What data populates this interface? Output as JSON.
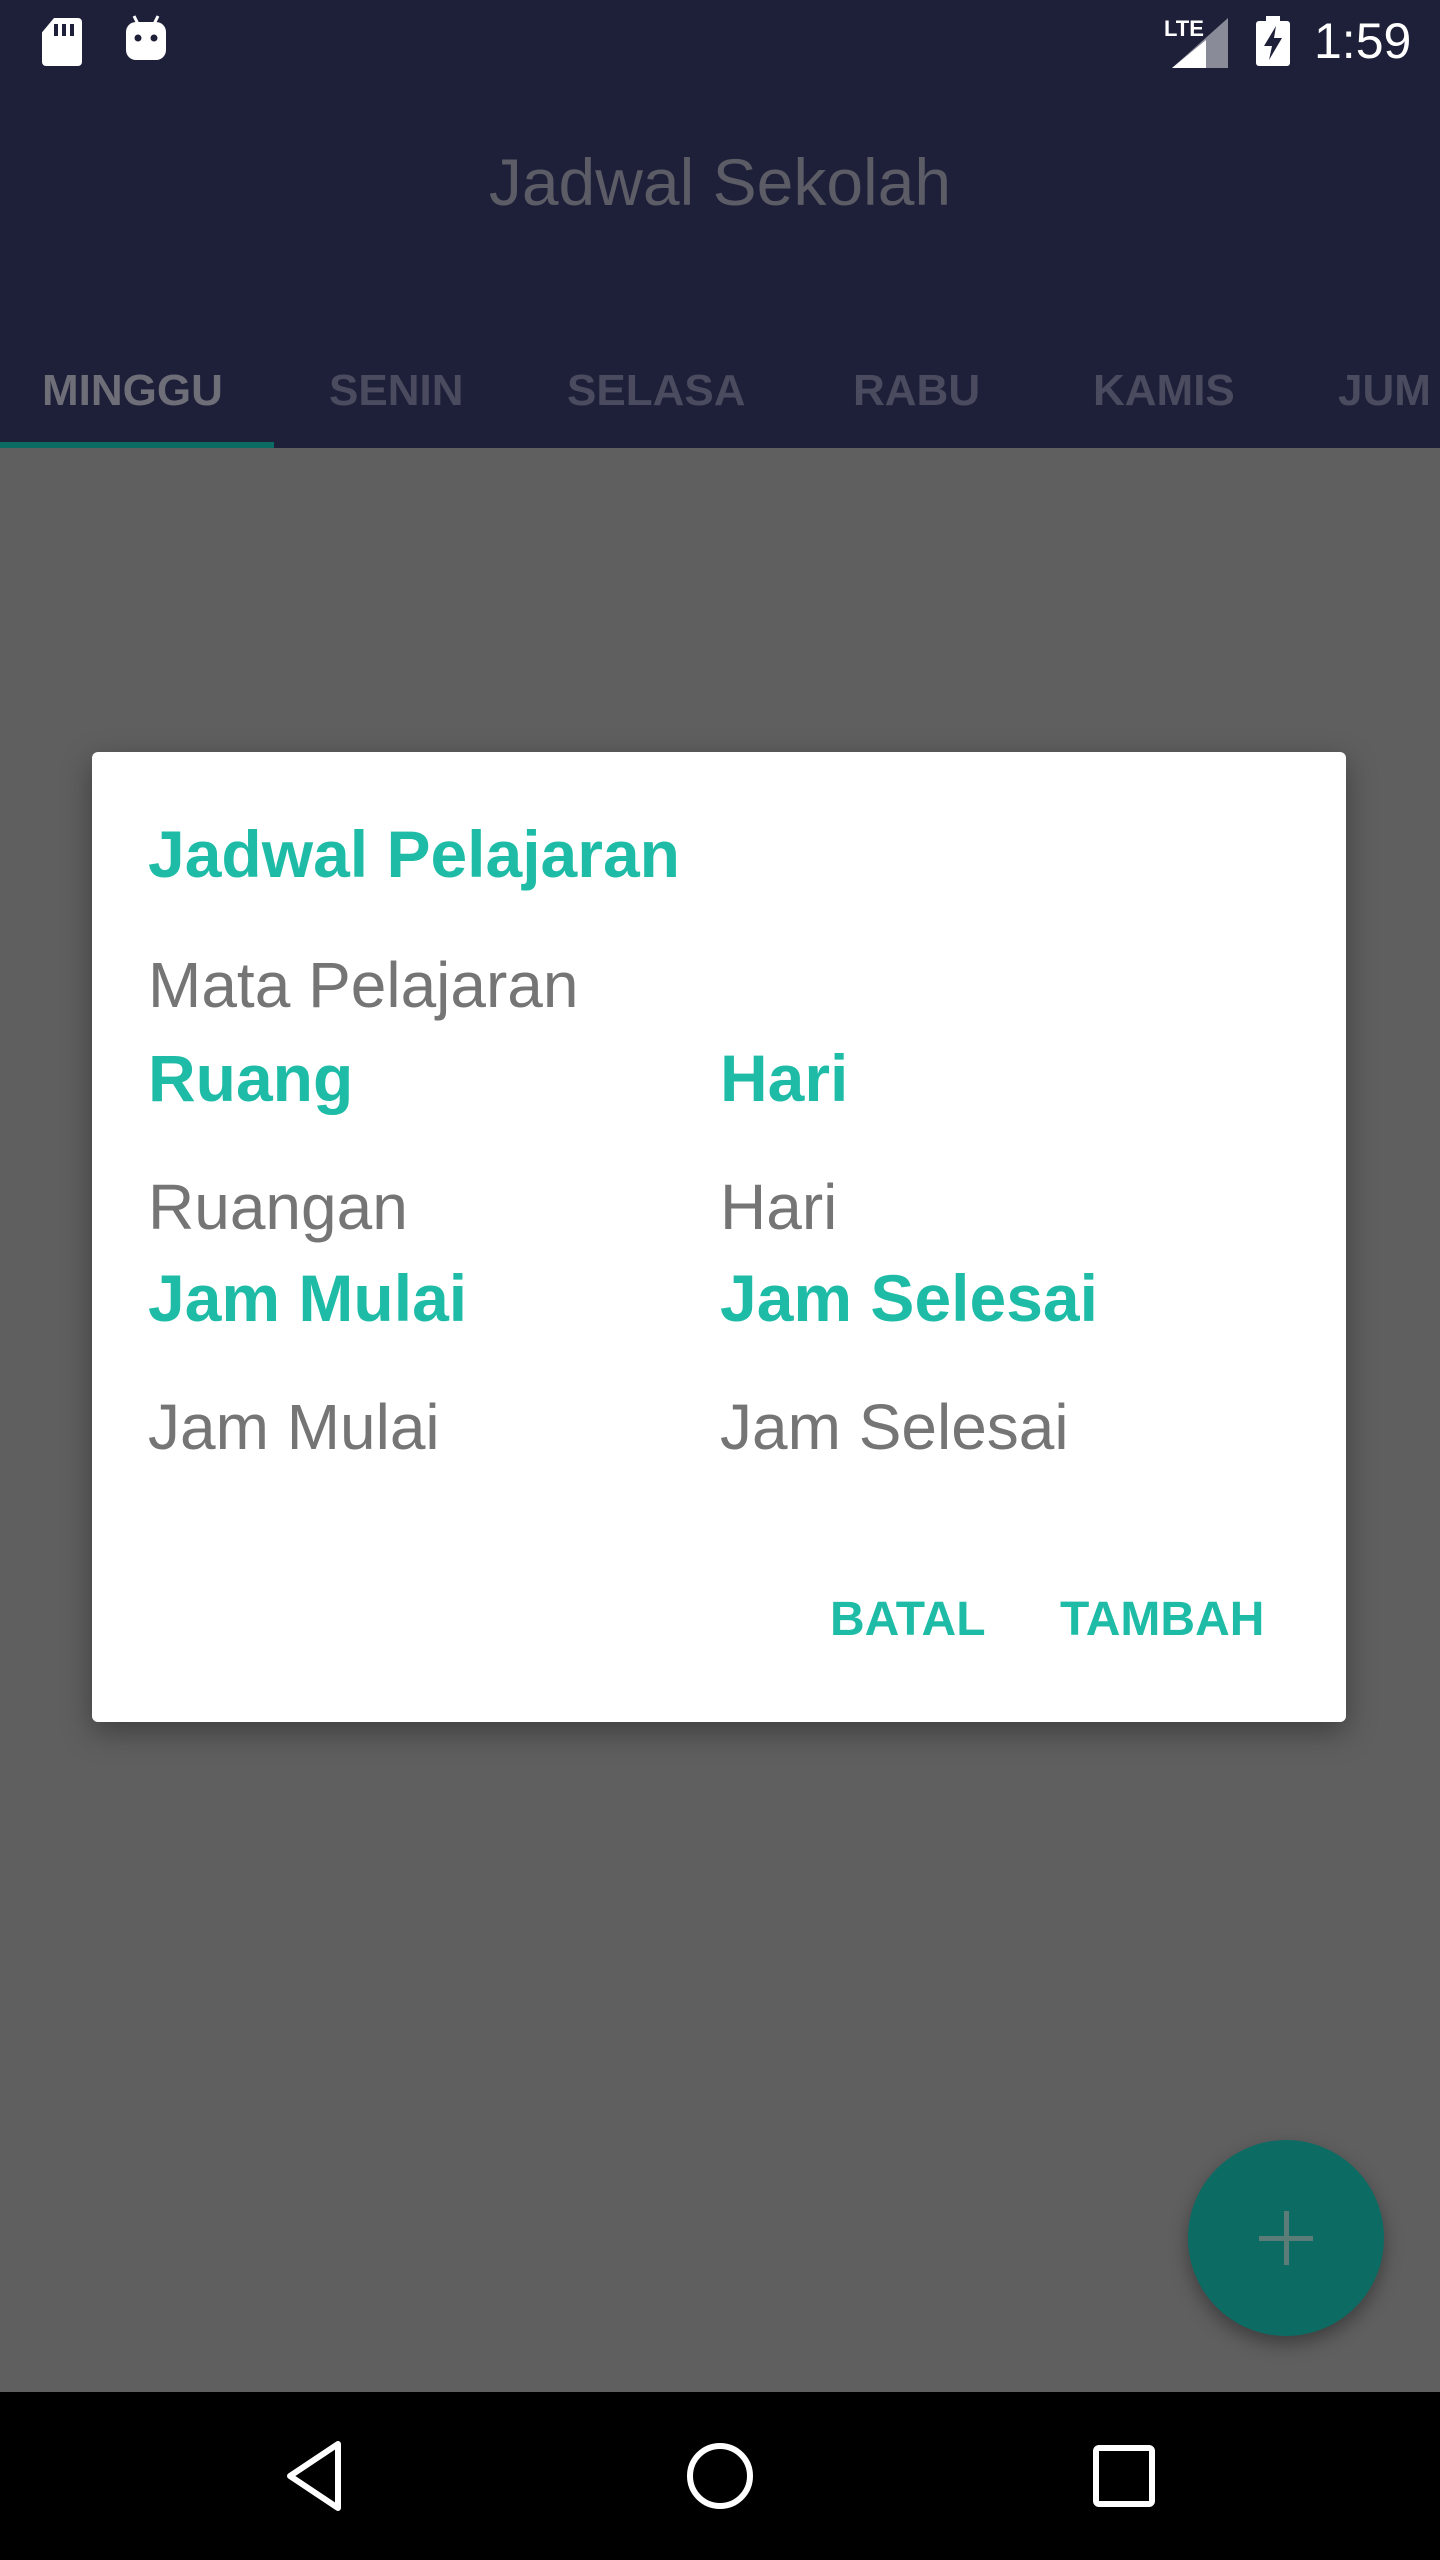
{
  "status_bar": {
    "network": "LTE",
    "time": "1:59",
    "icons": [
      "sd-card-icon",
      "android-icon",
      "signal-icon",
      "battery-charging-icon"
    ]
  },
  "app_bar": {
    "title": "Jadwal Sekolah",
    "tabs": [
      {
        "label": "MINGGU",
        "active": true
      },
      {
        "label": "SENIN"
      },
      {
        "label": "SELASA"
      },
      {
        "label": "RABU"
      },
      {
        "label": "KAMIS"
      },
      {
        "label": "JUM"
      }
    ]
  },
  "dialog": {
    "title": "Jadwal Pelajaran",
    "subject_placeholder": "Mata Pelajaran",
    "room_label": "Ruang",
    "room_placeholder": "Ruangan",
    "day_label": "Hari",
    "day_placeholder": "Hari",
    "start_label": "Jam Mulai",
    "start_placeholder": "Jam Mulai",
    "end_label": "Jam Selesai",
    "end_placeholder": "Jam Selesai",
    "cancel_button": "BATAL",
    "add_button": "TAMBAH"
  },
  "fab": {
    "icon": "plus-icon"
  },
  "nav_bar": {
    "icons": [
      "back-icon",
      "home-icon",
      "recents-icon"
    ]
  },
  "colors": {
    "primary": "#1e2039",
    "accent": "#1ebca6",
    "fab": "#0c6c64",
    "scrim": "#5f5f5f"
  }
}
